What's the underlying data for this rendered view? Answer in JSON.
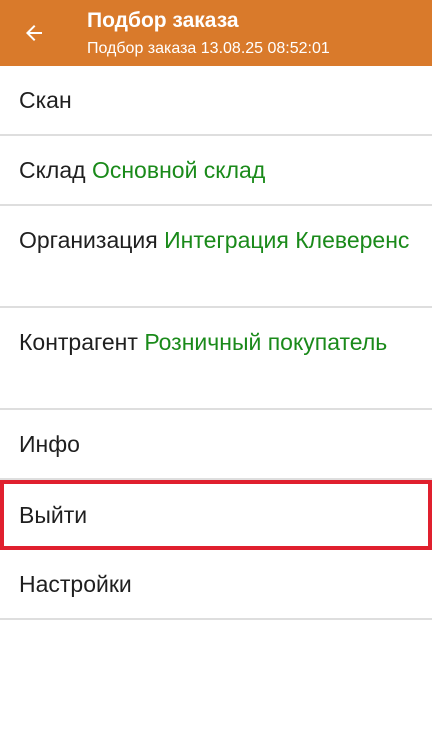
{
  "header": {
    "title": "Подбор заказа",
    "subtitle": "Подбор заказа 13.08.25 08:52:01",
    "back_icon": "arrow-left-icon",
    "color": "#d97a2b"
  },
  "menu": {
    "scan": {
      "label": "Скан"
    },
    "warehouse": {
      "label": "Склад",
      "value": "Основной склад"
    },
    "organization": {
      "label": "Организация",
      "value": "Интеграция Клеверенс"
    },
    "counterparty": {
      "label": "Контрагент",
      "value": "Розничный покупатель"
    },
    "info": {
      "label": "Инфо"
    },
    "exit": {
      "label": "Выйти"
    },
    "settings": {
      "label": "Настройки"
    }
  },
  "colors": {
    "value_text": "#1a8a1a",
    "highlight": "#e0202e",
    "divider": "#dedede"
  }
}
